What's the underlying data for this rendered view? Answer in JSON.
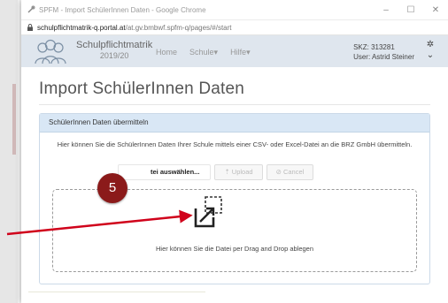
{
  "window": {
    "title": "SPFM - Import SchülerInnen Daten - Google Chrome",
    "minimize_glyph": "–",
    "maximize_glyph": "☐",
    "close_glyph": "✕"
  },
  "address": {
    "domain": "schulpflichtmatrik-q.portal.at",
    "path": "/at.gv.bmbwf.spfm-q/pages/#/start"
  },
  "navbar": {
    "brand_name": "Schulpflichtmatrik",
    "brand_year": "2019/20",
    "links": [
      "Home",
      "Schule",
      "Hilfe"
    ],
    "skz_label": "SKZ: 313281",
    "user_label": "User: Astrid Steiner",
    "settings_glyph": "✲",
    "dropdown_glyph": "⌄"
  },
  "page": {
    "title": "Import SchülerInnen Daten"
  },
  "panel": {
    "heading": "SchülerInnen Daten übermitteln",
    "description": "Hier können Sie die SchülerInnen Daten Ihrer Schule mittels einer CSV- oder Excel-Datei an die BRZ GmbH übermitteln.",
    "buttons": {
      "choose": "tei auswählen...",
      "upload": "⇡ Upload",
      "cancel": "⊘ Cancel"
    },
    "dropzone_text": "Hier können Sie die Datei per Drag and Drop ablegen"
  },
  "annotation": {
    "step_number": "5",
    "color": "#d0021b"
  },
  "colors": {
    "navbar_bg": "#dfe6ee",
    "panel_head_bg": "#d9e7f5",
    "badge_bg": "#8b1a1a"
  }
}
